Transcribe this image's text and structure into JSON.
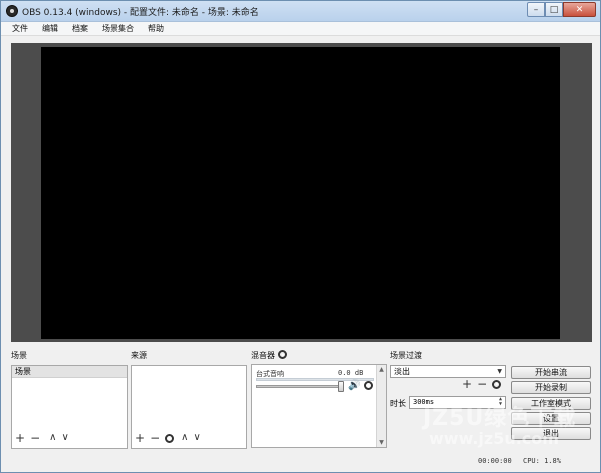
{
  "window": {
    "title": "OBS 0.13.4 (windows) - 配置文件: 未命名 - 场景: 未命名",
    "min_symbol": "–",
    "max_symbol": "□",
    "close_symbol": "✕"
  },
  "menubar": {
    "items": [
      "文件",
      "编辑",
      "档案",
      "场景集合",
      "帮助"
    ]
  },
  "scenes": {
    "title": "场景",
    "items": [
      "场景"
    ],
    "toolbar": {
      "add": "+",
      "remove": "−",
      "up": "∧",
      "down": "∨"
    }
  },
  "sources": {
    "title": "来源",
    "toolbar": {
      "add": "+",
      "remove": "−",
      "up": "∧",
      "down": "∨"
    }
  },
  "mixer": {
    "title": "混音器",
    "channel_name": "台式音响",
    "db_value": "0.0 dB",
    "volume_level": 1.0
  },
  "transitions": {
    "title": "场景过渡",
    "selected": "淡出",
    "add": "+",
    "remove": "−",
    "duration_label": "时长",
    "duration_value": "300ms"
  },
  "controls": {
    "start_streaming": "开始串流",
    "start_recording": "开始录制",
    "studio_mode": "工作室模式",
    "settings": "设置",
    "exit": "退出"
  },
  "status": {
    "time": "00:00:00",
    "cpu": "CPU: 1.8%"
  },
  "watermark": {
    "line1": "JZ5U绿色下载",
    "line2": "www.jz5u.com"
  },
  "colors": {
    "preview_bg": "#4c4c4c",
    "canvas": "#000000",
    "title_bar": "#c4d8ef"
  }
}
